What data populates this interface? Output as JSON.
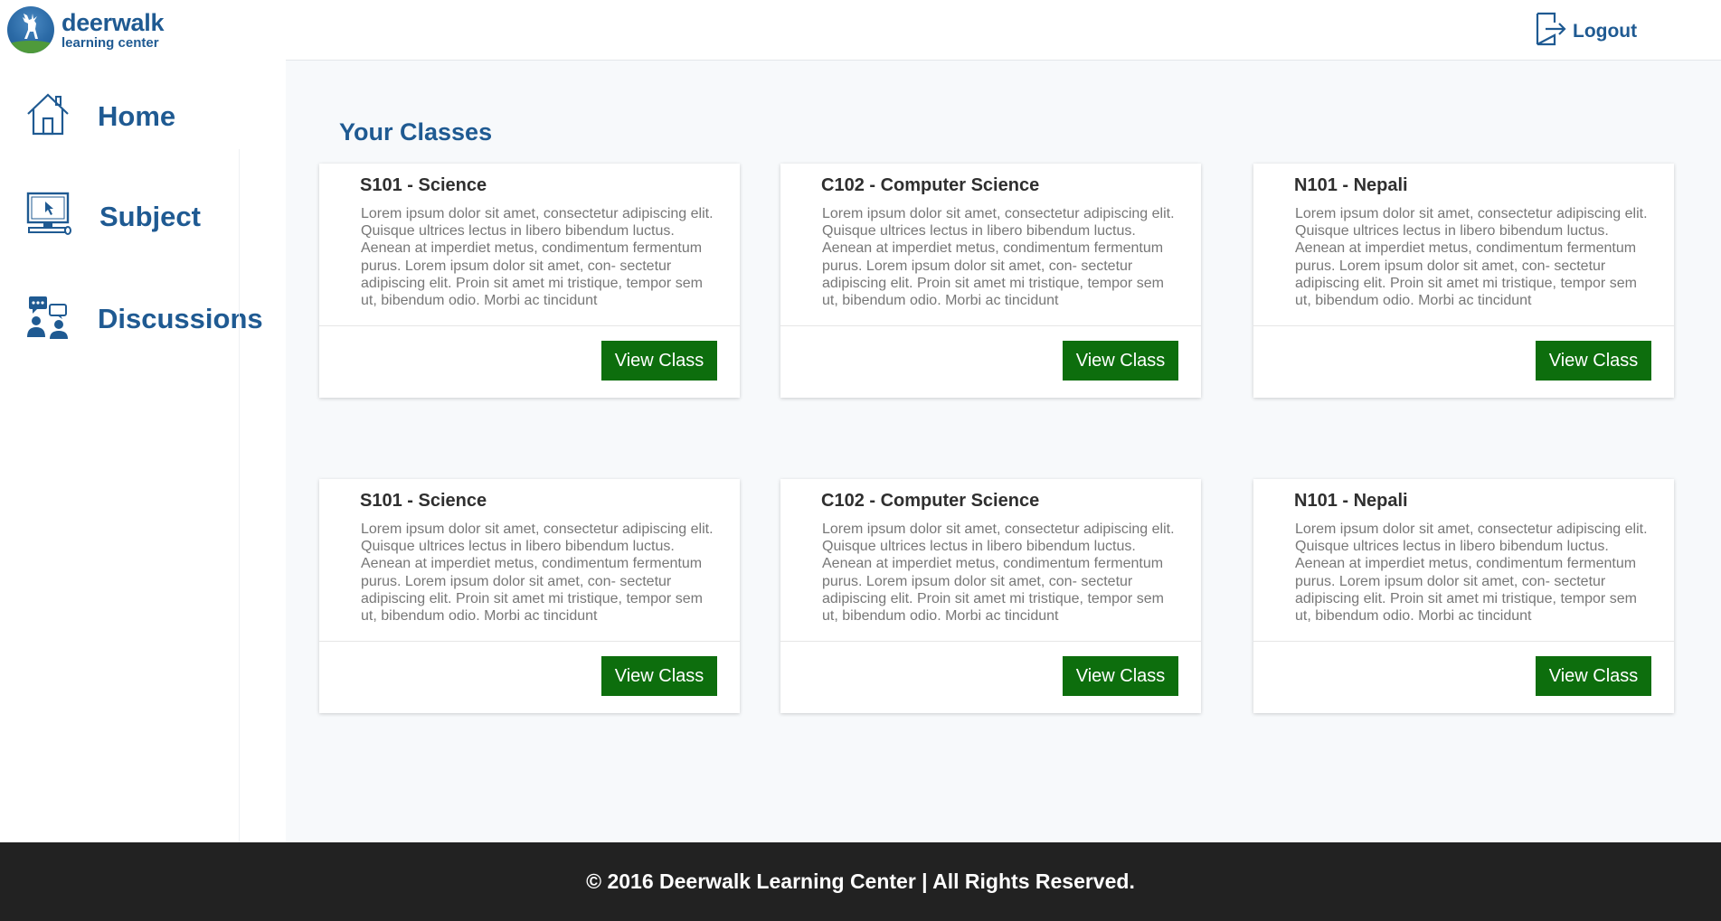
{
  "app": {
    "logo_title": "deerwalk",
    "logo_subtitle": "learning center"
  },
  "header": {
    "logout_label": "Logout"
  },
  "sidebar": {
    "items": [
      {
        "label": "Home",
        "icon": "home-icon"
      },
      {
        "label": "Subject",
        "icon": "monitor-icon"
      },
      {
        "label": "Discussions",
        "icon": "discussion-icon"
      }
    ]
  },
  "main": {
    "title": "Your Classes",
    "button_label": "View Class",
    "cards": [
      {
        "title": "S101 - Science",
        "description": "Lorem ipsum dolor sit amet, consectetur adipiscing elit. Quisque ultrices lectus in libero bibendum luctus. Aenean at imperdiet metus, condimentum fermentum purus. Lorem ipsum dolor sit amet, con- sectetur adipiscing elit. Proin sit amet mi tristique, tempor sem ut, bibendum odio. Morbi ac tincidunt"
      },
      {
        "title": "C102 - Computer Science",
        "description": "Lorem ipsum dolor sit amet, consectetur adipiscing elit. Quisque ultrices lectus in libero bibendum luctus. Aenean at imperdiet metus, condimentum fermentum purus. Lorem ipsum dolor sit amet, con- sectetur adipiscing elit. Proin sit amet mi tristique, tempor sem ut, bibendum odio. Morbi ac tincidunt"
      },
      {
        "title": "N101 - Nepali",
        "description": "Lorem ipsum dolor sit amet, consectetur adipiscing elit. Quisque ultrices lectus in libero bibendum luctus. Aenean at imperdiet metus, condimentum fermentum purus. Lorem ipsum dolor sit amet, con- sectetur adipiscing elit. Proin sit amet mi tristique, tempor sem ut, bibendum odio. Morbi ac tincidunt"
      },
      {
        "title": "S101 - Science",
        "description": "Lorem ipsum dolor sit amet, consectetur adipiscing elit. Quisque ultrices lectus in libero bibendum luctus. Aenean at imperdiet metus, condimentum fermentum purus. Lorem ipsum dolor sit amet, con- sectetur adipiscing elit. Proin sit amet mi tristique, tempor sem ut, bibendum odio. Morbi ac tincidunt"
      },
      {
        "title": "C102 - Computer Science",
        "description": "Lorem ipsum dolor sit amet, consectetur adipiscing elit. Quisque ultrices lectus in libero bibendum luctus. Aenean at imperdiet metus, condimentum fermentum purus. Lorem ipsum dolor sit amet, con- sectetur adipiscing elit. Proin sit amet mi tristique, tempor sem ut, bibendum odio. Morbi ac tincidunt"
      },
      {
        "title": "N101 - Nepali",
        "description": "Lorem ipsum dolor sit amet, consectetur adipiscing elit. Quisque ultrices lectus in libero bibendum luctus. Aenean at imperdiet metus, condimentum fermentum purus. Lorem ipsum dolor sit amet, con- sectetur adipiscing elit. Proin sit amet mi tristique, tempor sem ut, bibendum odio. Morbi ac tincidunt"
      }
    ]
  },
  "footer": {
    "text": "© 2016 Deerwalk Learning Center | All Rights Reserved."
  },
  "colors": {
    "brand_blue": "#1f5a92",
    "button_green": "#0d6e0d",
    "footer_bg": "#222222",
    "main_bg": "#f7f9fb"
  }
}
